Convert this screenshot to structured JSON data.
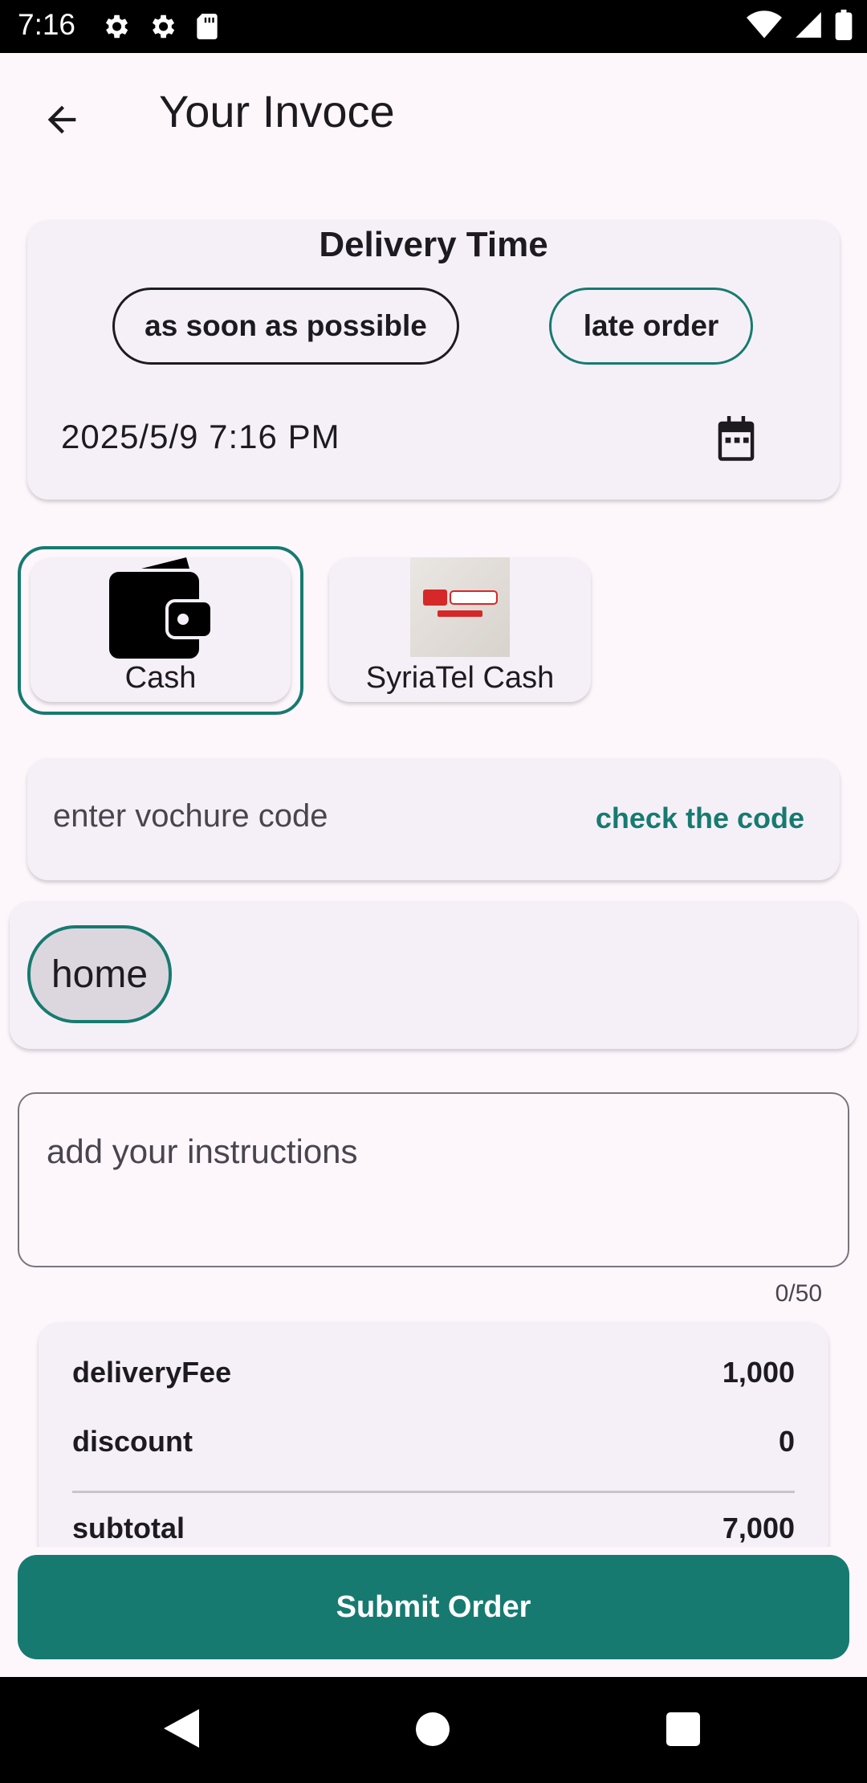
{
  "status_bar": {
    "time": "7:16",
    "left_icons": [
      "gear-icon",
      "gear-icon",
      "sd-card-icon"
    ],
    "right_icons": [
      "wifi-icon",
      "signal-icon",
      "battery-icon"
    ]
  },
  "app_bar": {
    "title": "Your Invoce",
    "back_icon": "arrow-back-icon"
  },
  "delivery": {
    "title": "Delivery Time",
    "option_asap": "as soon as possible",
    "option_late": "late order",
    "datetime": "2025/5/9  7:16 PM",
    "calendar_icon": "calendar-icon"
  },
  "payment": {
    "methods": [
      {
        "label": "Cash",
        "icon": "wallet-icon",
        "selected": true
      },
      {
        "label": "SyriaTel Cash",
        "icon": "syriatel-cash-logo",
        "selected": false
      }
    ]
  },
  "voucher": {
    "placeholder": "enter vochure code",
    "check_label": "check the code"
  },
  "address": {
    "chip": "home"
  },
  "instructions": {
    "placeholder": "add your instructions",
    "counter": "0/50"
  },
  "summary": {
    "rows": [
      {
        "label": "deliveryFee",
        "value": "1,000"
      },
      {
        "label": "discount",
        "value": "0"
      },
      {
        "label": "subtotal",
        "value": "7,000"
      }
    ]
  },
  "submit": {
    "label": "Submit Order"
  },
  "colors": {
    "accent": "#177a70",
    "background": "#fdf7fc",
    "card": "#f5f0f7"
  }
}
